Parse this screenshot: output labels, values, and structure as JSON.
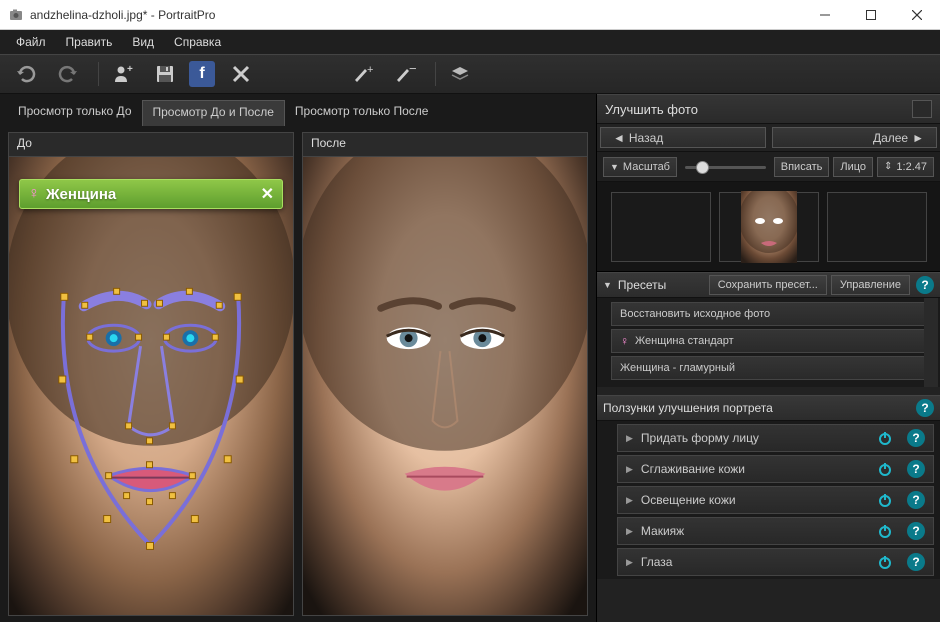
{
  "window": {
    "filename": "andzhelina-dzholi.jpg*",
    "appname": "PortraitPro"
  },
  "menu": {
    "file": "Файл",
    "edit": "Править",
    "view": "Вид",
    "help": "Справка"
  },
  "viewtabs": {
    "before_only": "Просмотр только До",
    "before_after": "Просмотр До и После",
    "after_only": "Просмотр только После"
  },
  "panes": {
    "before": "До",
    "after": "После"
  },
  "gender_tag": {
    "label": "Женщина"
  },
  "right": {
    "improve_title": "Улучшить фото",
    "back": "Назад",
    "next": "Далее",
    "zoom_label": "Масштаб",
    "fit": "Вписать",
    "face": "Лицо",
    "ratio": "1:2.47",
    "presets_label": "Пресеты",
    "save_preset": "Сохранить пресет...",
    "manage": "Управление",
    "presets": {
      "restore": "Восстановить исходное фото",
      "woman_std": "Женщина стандарт",
      "woman_glam": "Женщина - гламурный"
    },
    "sliders_title": "Ползунки улучшения портрета",
    "sliders": {
      "face_shape": "Придать форму лицу",
      "skin_smooth": "Сглаживание кожи",
      "skin_light": "Освещение кожи",
      "makeup": "Макияж",
      "eyes": "Глаза"
    }
  }
}
